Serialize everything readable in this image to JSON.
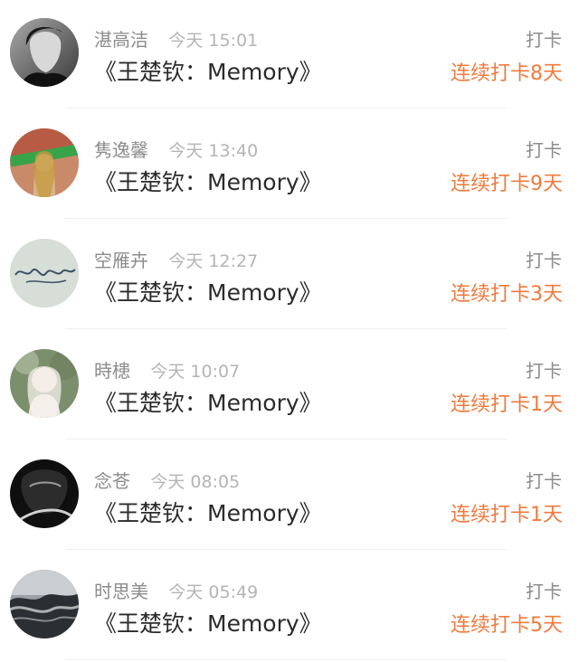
{
  "colors": {
    "accent": "#f07a3c",
    "name_gray": "#8c8c8c",
    "time_gray": "#b4b4b4",
    "title_dark": "#2b2b2b"
  },
  "entries": [
    {
      "name": "湛高洁",
      "time": "今天 15:01",
      "title": "《王楚钦：Memory》",
      "action": "打卡",
      "streak": "连续打卡8天",
      "avatar_icon": "portrait-avatar"
    },
    {
      "name": "隽逸馨",
      "time": "今天 13:40",
      "title": "《王楚钦：Memory》",
      "action": "打卡",
      "streak": "连续打卡9天",
      "avatar_icon": "photo-avatar"
    },
    {
      "name": "空雁卉",
      "time": "今天 12:27",
      "title": "《王楚钦：Memory》",
      "action": "打卡",
      "streak": "连续打卡3天",
      "avatar_icon": "signature-avatar"
    },
    {
      "name": "時槵",
      "time": "今天 10:07",
      "title": "《王楚钦：Memory》",
      "action": "打卡",
      "streak": "连续打卡1天",
      "avatar_icon": "portrait-avatar"
    },
    {
      "name": "念苍",
      "time": "今天 08:05",
      "title": "《王楚钦：Memory》",
      "action": "打卡",
      "streak": "连续打卡1天",
      "avatar_icon": "portrait-avatar"
    },
    {
      "name": "时思美",
      "time": "今天 05:49",
      "title": "《王楚钦：Memory》",
      "action": "打卡",
      "streak": "连续打卡5天",
      "avatar_icon": "landscape-avatar"
    }
  ]
}
